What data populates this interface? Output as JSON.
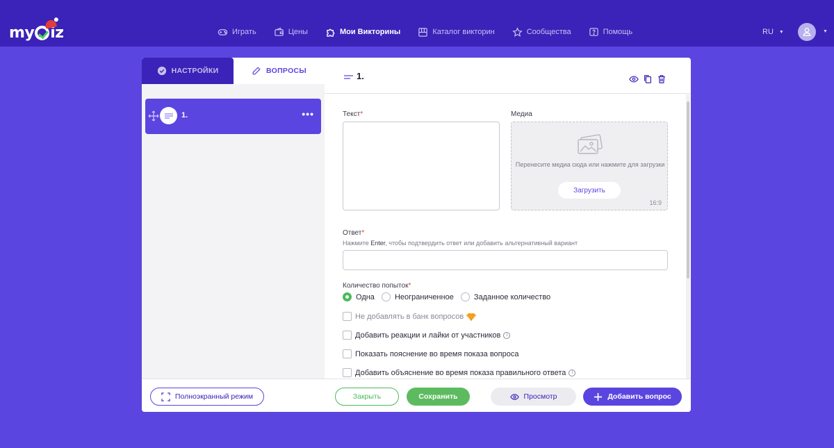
{
  "brand": {
    "logo_text_pre": "my",
    "logo_text_post": "iz"
  },
  "nav": [
    {
      "label": "Играть",
      "icon": "gamepad-icon",
      "active": false
    },
    {
      "label": "Цены",
      "icon": "wallet-icon",
      "active": false
    },
    {
      "label": "Мои Викторины",
      "icon": "puzzle-icon",
      "active": true
    },
    {
      "label": "Каталог викторин",
      "icon": "catalog-icon",
      "active": false
    },
    {
      "label": "Сообщества",
      "icon": "star-icon",
      "active": false
    },
    {
      "label": "Помощь",
      "icon": "help-icon",
      "active": false
    }
  ],
  "header": {
    "language": "RU"
  },
  "tabs": {
    "settings": "НАСТРОЙКИ",
    "questions": "ВОПРОСЫ"
  },
  "question_list": [
    {
      "number": "1.",
      "more": "•••"
    }
  ],
  "editor": {
    "title": "1.",
    "text_label": "Текст",
    "media_label": "Медиа",
    "media_hint": "Перенесите медиа сюда или нажмите для загрузки",
    "upload_label": "Загрузить",
    "aspect_ratio": "16:9",
    "answer_label": "Ответ",
    "answer_hint_pre": "Нажмите ",
    "answer_hint_key": "Enter",
    "answer_hint_post": ", чтобы подтвердить ответ или добавить альтернативный вариант",
    "answer_value": "",
    "attempts_label": "Количество попыток",
    "required_mark": "*",
    "attempt_options": [
      {
        "label": "Одна",
        "selected": true
      },
      {
        "label": "Неограниченное",
        "selected": false
      },
      {
        "label": "Заданное количество",
        "selected": false
      }
    ],
    "checkboxes": [
      {
        "label": "Не добавлять в банк вопросов",
        "checked": false,
        "premium": true
      },
      {
        "label": "Добавить реакции и лайки от участников",
        "checked": false,
        "info": true
      },
      {
        "label": "Показать пояснение во время показа вопроса",
        "checked": false
      },
      {
        "label": "Добавить объяснение во время показа правильного ответа",
        "checked": false,
        "info": true
      }
    ]
  },
  "footer": {
    "fullscreen": "Полноэкранный режим",
    "close": "Закрыть",
    "save": "Сохранить",
    "preview": "Просмотр",
    "add_question": "Добавить вопрос"
  },
  "colors": {
    "nav_bg": "#3b22b8",
    "page_bg": "#5a45e0",
    "accent": "#5a45e0",
    "success": "#4cba5c",
    "required": "#e23b3b"
  }
}
